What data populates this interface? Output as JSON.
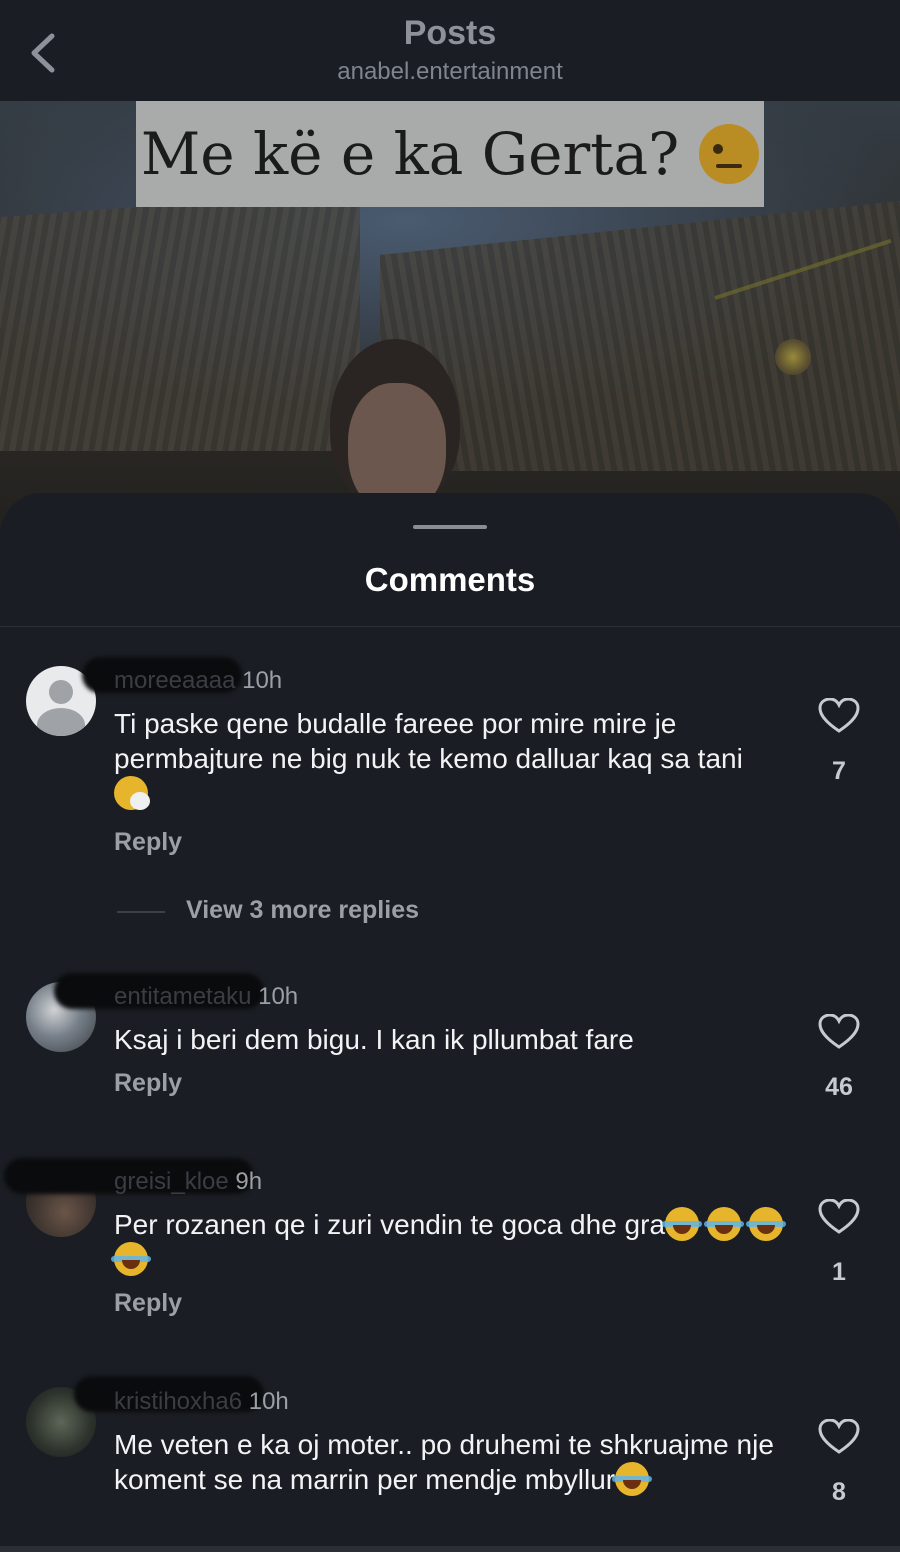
{
  "header": {
    "back_icon": "chevron-left-icon",
    "title": "Posts",
    "subtitle": "anabel.entertainment"
  },
  "post": {
    "caption": "Me kë e ka Gerta?",
    "caption_emoji": "raised-eyebrow-emoji"
  },
  "comments_sheet": {
    "title": "Comments",
    "comments": [
      {
        "username": "moreeaaaa",
        "time": "10h",
        "text": "Ti paske qene budalle fareee por mire mire je permbajture ne big nuk te kemo dalluar kaq sa tani",
        "emoji": "sneezing-face-emoji",
        "reply_label": "Reply",
        "likes": "7",
        "view_replies": "View 3 more replies"
      },
      {
        "username": "entitametaku",
        "time": "10h",
        "text": "Ksaj i beri dem bigu. I kan ik pllumbat fare",
        "reply_label": "Reply",
        "likes": "46"
      },
      {
        "username": "greisi_kloe",
        "time": "9h",
        "text": "Per rozanen qe i zuri vendin te goca dhe gra",
        "emoji": "tears-of-joy-emoji",
        "reply_label": "Reply",
        "likes": "1"
      },
      {
        "username": "kristihoxha6",
        "time": "10h",
        "text": "Me veten e ka oj moter.. po druhemi  te shkruajme nje koment se na marrin per mendje mbyllur",
        "emoji": "tears-of-joy-emoji",
        "reply_label": "Reply",
        "likes": "8"
      }
    ]
  },
  "colors": {
    "background": "#1a1e24",
    "secondary_text": "#9ba0a7",
    "primary_text": "#f2f3f5"
  }
}
